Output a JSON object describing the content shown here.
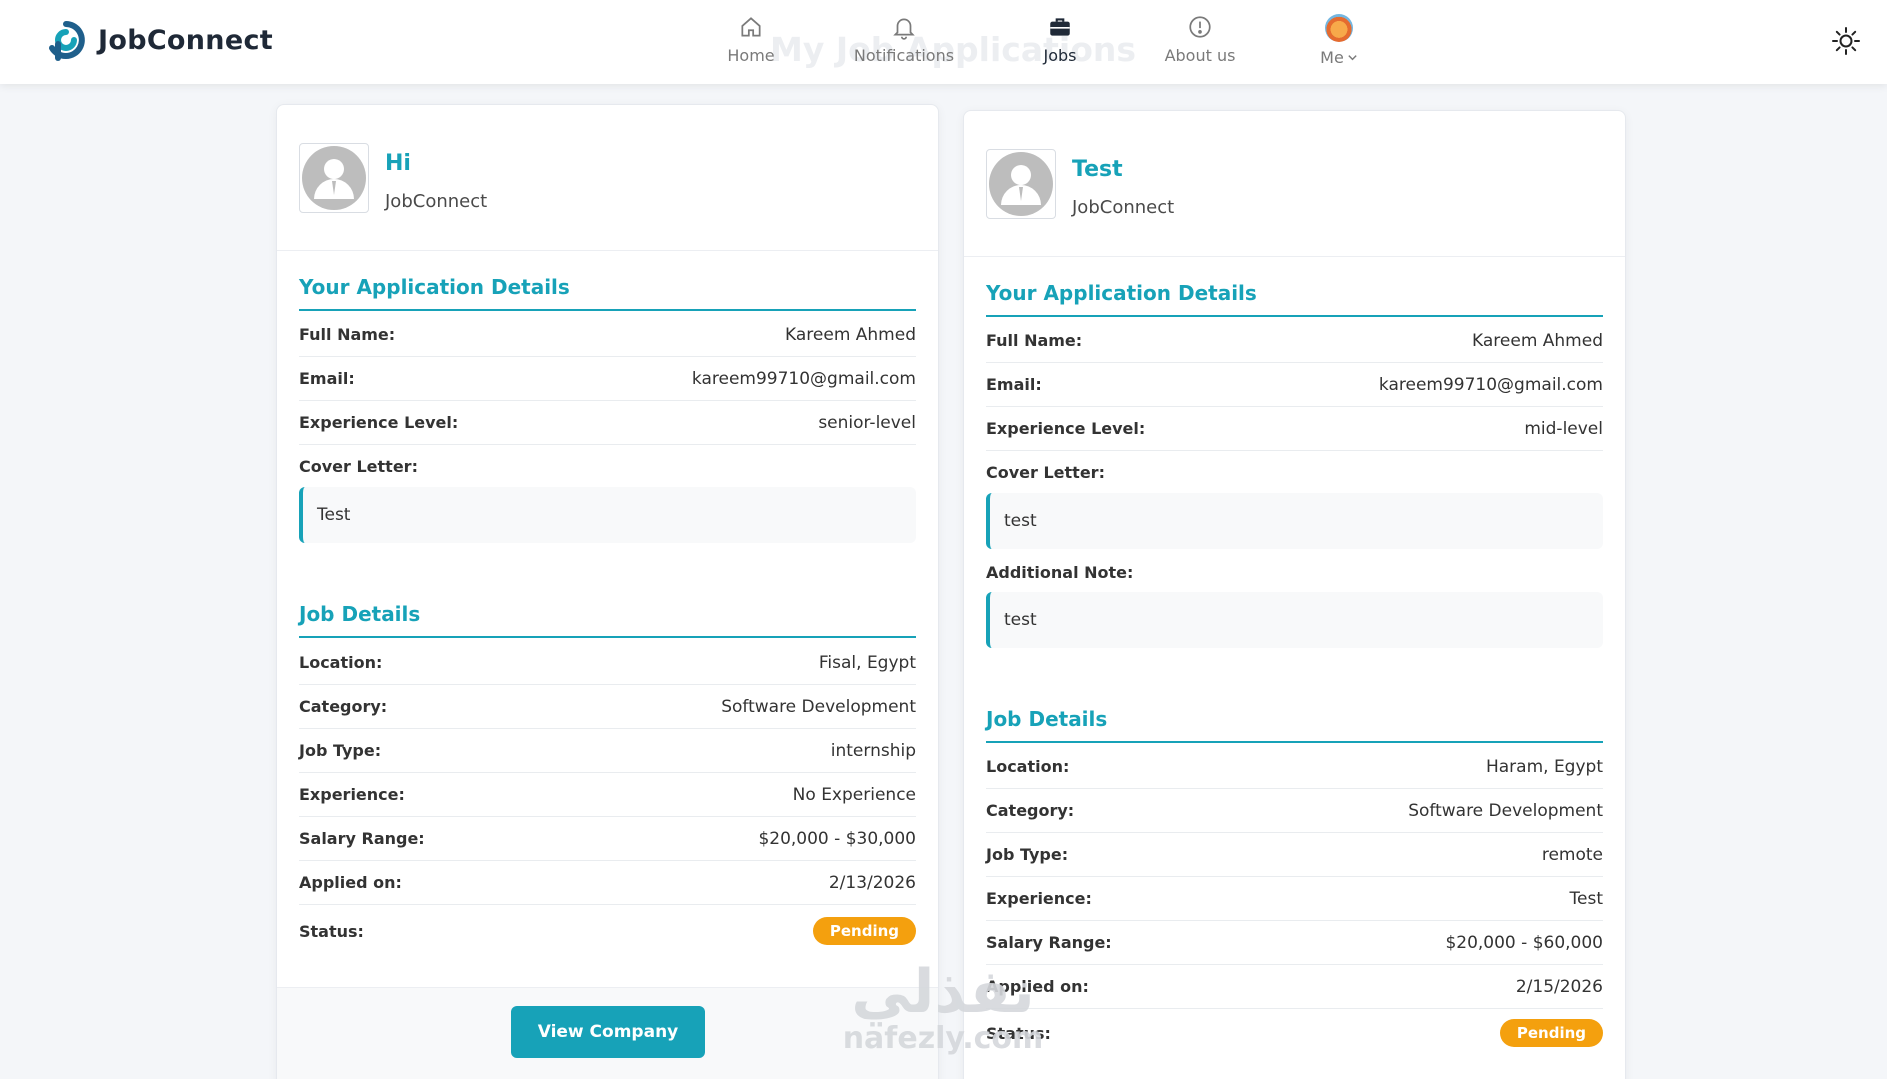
{
  "navbar": {
    "brand": "JobConnect",
    "ghost_title": "My Job Applications",
    "items": [
      {
        "label": "Home",
        "icon": "home-icon"
      },
      {
        "label": "Notifications",
        "icon": "bell-icon"
      },
      {
        "label": "Jobs",
        "icon": "briefcase-icon"
      },
      {
        "label": "About us",
        "icon": "info-icon"
      },
      {
        "label": "Me",
        "icon": "avatar"
      }
    ],
    "theme_icon": "sun-icon"
  },
  "applications": [
    {
      "title": "Hi",
      "company": "JobConnect",
      "application_section": "Your Application Details",
      "full_name_label": "Full Name:",
      "full_name": "Kareem Ahmed",
      "email_label": "Email:",
      "email": "kareem99710@gmail.com",
      "experience_level_label": "Experience Level:",
      "experience_level": "senior-level",
      "cover_letter_label": "Cover Letter:",
      "cover_letter": "Test",
      "job_section": "Job Details",
      "location_label": "Location:",
      "location": "Fisal, Egypt",
      "category_label": "Category:",
      "category": "Software Development",
      "job_type_label": "Job Type:",
      "job_type": "internship",
      "experience_label": "Experience:",
      "experience": "No Experience",
      "salary_label": "Salary Range:",
      "salary": "$20,000 - $30,000",
      "applied_label": "Applied on:",
      "applied": "2/13/2026",
      "status_label": "Status:",
      "status": "Pending",
      "button_label": "View Company"
    },
    {
      "title": "Test",
      "company": "JobConnect",
      "application_section": "Your Application Details",
      "full_name_label": "Full Name:",
      "full_name": "Kareem Ahmed",
      "email_label": "Email:",
      "email": "kareem99710@gmail.com",
      "experience_level_label": "Experience Level:",
      "experience_level": "mid-level",
      "cover_letter_label": "Cover Letter:",
      "cover_letter": "test",
      "note_label": "Additional Note:",
      "note": "test",
      "job_section": "Job Details",
      "location_label": "Location:",
      "location": "Haram, Egypt",
      "category_label": "Category:",
      "category": "Software Development",
      "job_type_label": "Job Type:",
      "job_type": "remote",
      "experience_label": "Experience:",
      "experience": "Test",
      "salary_label": "Salary Range:",
      "salary": "$20,000 - $60,000",
      "applied_label": "Applied on:",
      "applied": "2/15/2026",
      "status_label": "Status:",
      "status": "Pending"
    }
  ],
  "colors": {
    "accent": "#17a2b8",
    "pending": "#f4a00e",
    "brand_dark": "#1f2937"
  },
  "watermark": {
    "arabic": "نفذلي",
    "latin": "nafezly.com"
  }
}
